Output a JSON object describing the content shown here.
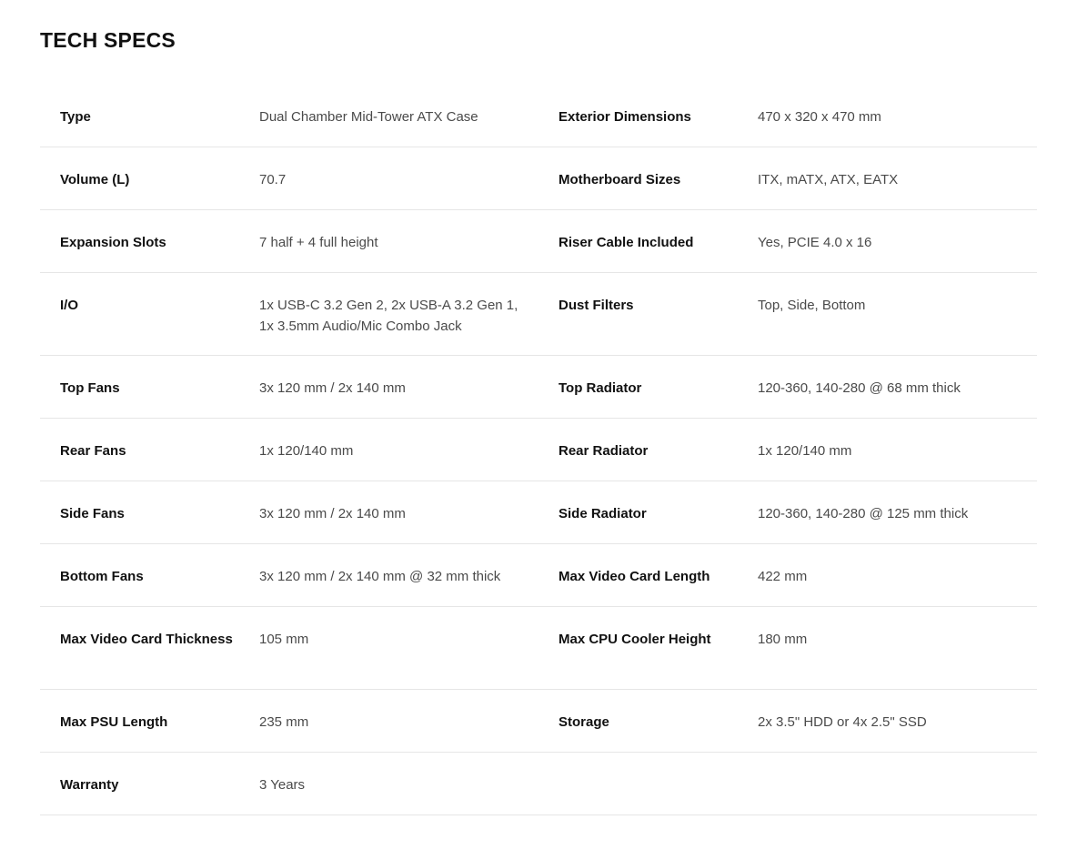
{
  "title": "TECH SPECS",
  "rows": [
    {
      "l1": "Type",
      "v1": "Dual Chamber Mid-Tower ATX Case",
      "l2": "Exterior Dimensions",
      "v2": "470 x 320 x 470 mm"
    },
    {
      "l1": "Volume (L)",
      "v1": "70.7",
      "l2": "Motherboard Sizes",
      "v2": "ITX, mATX, ATX, EATX"
    },
    {
      "l1": "Expansion Slots",
      "v1": "7 half + 4 full height",
      "l2": "Riser Cable Included",
      "v2": "Yes, PCIE 4.0 x 16"
    },
    {
      "l1": "I/O",
      "v1": "1x USB-C 3.2 Gen 2, 2x USB-A 3.2 Gen 1, 1x 3.5mm Audio/Mic Combo Jack",
      "l2": "Dust Filters",
      "v2": "Top, Side, Bottom"
    },
    {
      "l1": "Top Fans",
      "v1": "3x 120 mm / 2x 140 mm",
      "l2": "Top Radiator",
      "v2": "120-360, 140-280 @ 68 mm thick"
    },
    {
      "l1": "Rear Fans",
      "v1": "1x 120/140 mm",
      "l2": "Rear Radiator",
      "v2": "1x 120/140 mm"
    },
    {
      "l1": "Side Fans",
      "v1": "3x 120 mm / 2x 140 mm",
      "l2": "Side Radiator",
      "v2": "120-360, 140-280 @ 125 mm thick"
    },
    {
      "l1": "Bottom Fans",
      "v1": "3x 120 mm / 2x 140 mm @ 32 mm thick",
      "l2": "Max Video Card Length",
      "v2": "422 mm"
    },
    {
      "l1": "Max Video Card Thickness",
      "v1": "105 mm",
      "l2": "Max CPU Cooler Height",
      "v2": "180 mm"
    },
    {
      "l1": "Max PSU Length",
      "v1": "235 mm",
      "l2": "Storage",
      "v2": "2x 3.5\" HDD or 4x 2.5\" SSD"
    },
    {
      "l1": "Warranty",
      "v1": "3 Years",
      "l2": "",
      "v2": ""
    }
  ]
}
